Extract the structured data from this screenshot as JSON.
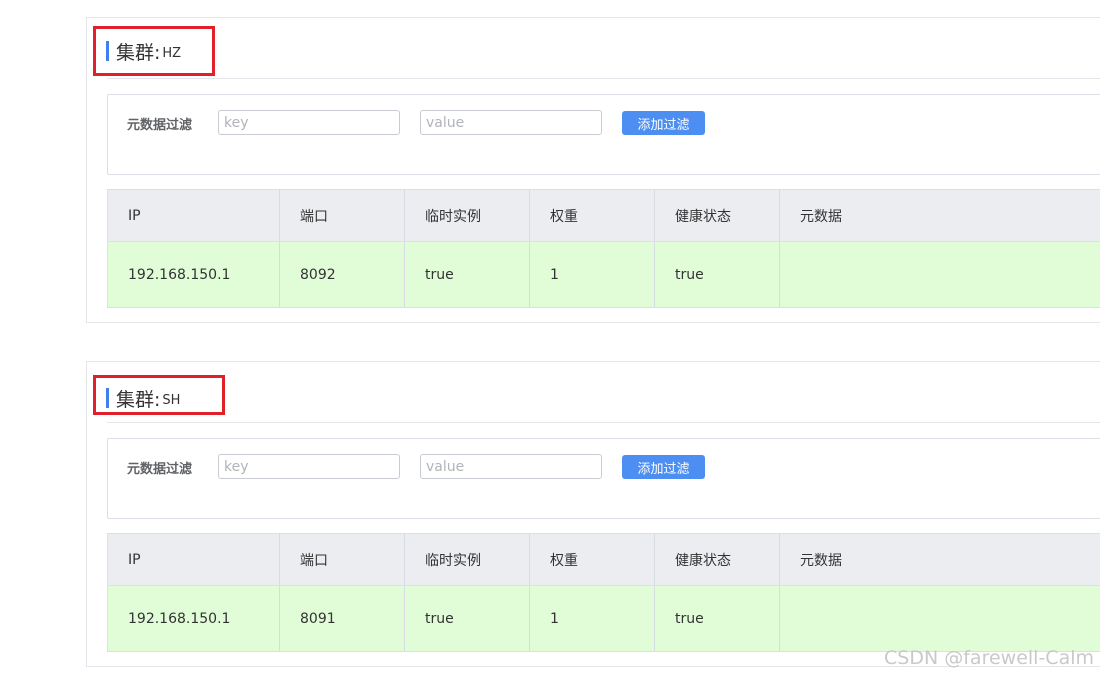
{
  "clusters": [
    {
      "label": "集群:",
      "name": "HZ",
      "filter": {
        "label": "元数据过滤",
        "key_placeholder": "key",
        "value_placeholder": "value",
        "button_label": "添加过滤"
      },
      "table": {
        "headers": [
          "IP",
          "端口",
          "临时实例",
          "权重",
          "健康状态",
          "元数据"
        ],
        "rows": [
          [
            "192.168.150.1",
            "8092",
            "true",
            "1",
            "true",
            ""
          ]
        ]
      }
    },
    {
      "label": "集群:",
      "name": "SH",
      "filter": {
        "label": "元数据过滤",
        "key_placeholder": "key",
        "value_placeholder": "value",
        "button_label": "添加过滤"
      },
      "table": {
        "headers": [
          "IP",
          "端口",
          "临时实例",
          "权重",
          "健康状态",
          "元数据"
        ],
        "rows": [
          [
            "192.168.150.1",
            "8091",
            "true",
            "1",
            "true",
            ""
          ]
        ]
      }
    }
  ],
  "watermark": "CSDN @farewell-Calm",
  "colors": {
    "accent_bar": "#3f7ff0",
    "highlight_box": "#e0202a",
    "button": "#4d8ef2",
    "table_header_bg": "#ebedf1",
    "healthy_row_bg": "#e1fdd8"
  }
}
